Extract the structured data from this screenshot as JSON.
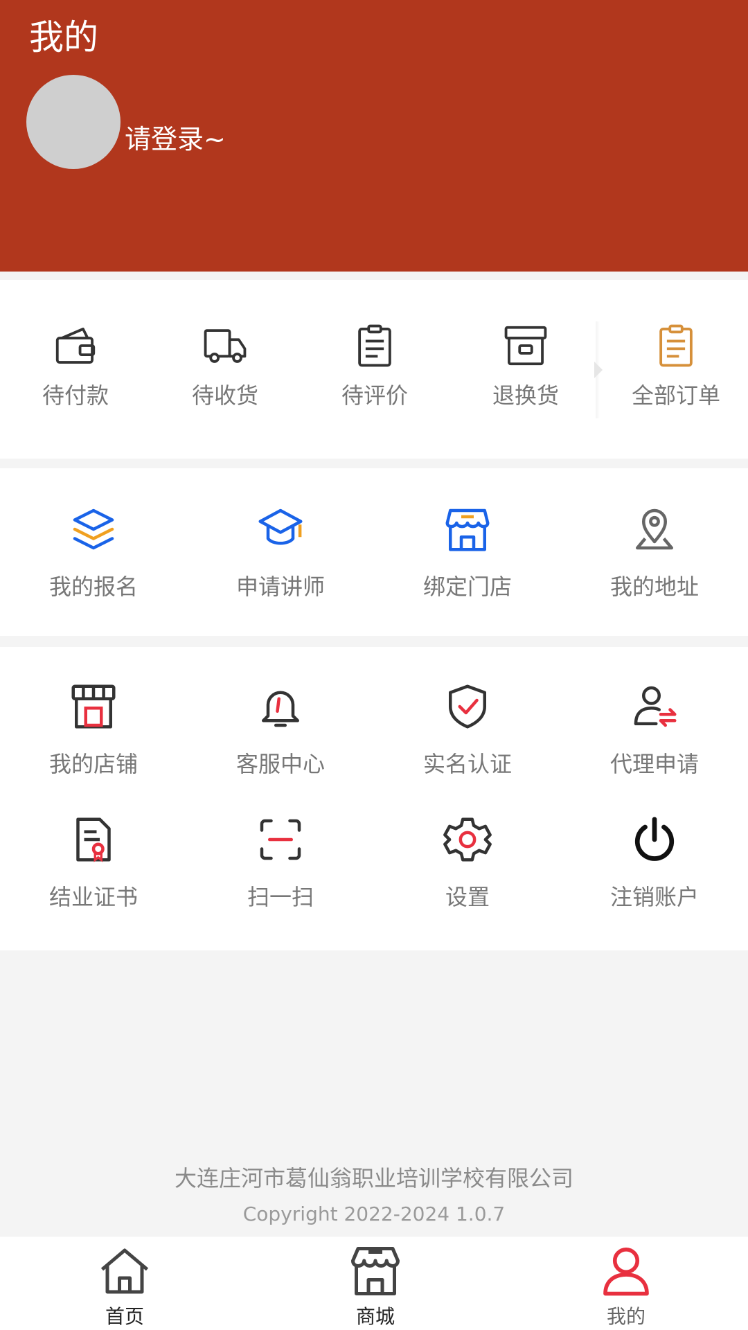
{
  "header": {
    "title": "我的",
    "login_prompt": "请登录~",
    "background_color": "#b1371d"
  },
  "orders": {
    "items": [
      {
        "label": "待付款",
        "icon": "wallet-icon"
      },
      {
        "label": "待收货",
        "icon": "truck-icon"
      },
      {
        "label": "待评价",
        "icon": "clipboard-icon"
      },
      {
        "label": "退换货",
        "icon": "return-box-icon"
      }
    ],
    "all_orders": {
      "label": "全部订单",
      "icon": "orders-clipboard-icon",
      "icon_color": "#d6903a"
    }
  },
  "features": {
    "items": [
      {
        "label": "我的报名",
        "icon": "layers-icon"
      },
      {
        "label": "申请讲师",
        "icon": "graduation-cap-icon"
      },
      {
        "label": "绑定门店",
        "icon": "storefront-icon"
      },
      {
        "label": "我的地址",
        "icon": "map-pin-icon"
      }
    ],
    "accent_color": "#1a63e8"
  },
  "services": {
    "items": [
      {
        "label": "我的店铺",
        "icon": "shop-icon"
      },
      {
        "label": "客服中心",
        "icon": "bell-icon"
      },
      {
        "label": "实名认证",
        "icon": "shield-check-icon"
      },
      {
        "label": "代理申请",
        "icon": "user-exchange-icon"
      },
      {
        "label": "结业证书",
        "icon": "certificate-icon"
      },
      {
        "label": "扫一扫",
        "icon": "scan-icon"
      },
      {
        "label": "设置",
        "icon": "gear-icon"
      },
      {
        "label": "注销账户",
        "icon": "power-icon"
      }
    ],
    "accent_color": "#e8303f"
  },
  "footer": {
    "company": "大连庄河市葛仙翁职业培训学校有限公司",
    "copyright": "Copyright 2022-2024 1.0.7"
  },
  "tabbar": {
    "tabs": [
      {
        "label": "首页",
        "icon": "home-icon"
      },
      {
        "label": "商城",
        "icon": "store-icon"
      },
      {
        "label": "我的",
        "icon": "user-icon",
        "active": true
      }
    ],
    "active_color": "#e8303f"
  }
}
